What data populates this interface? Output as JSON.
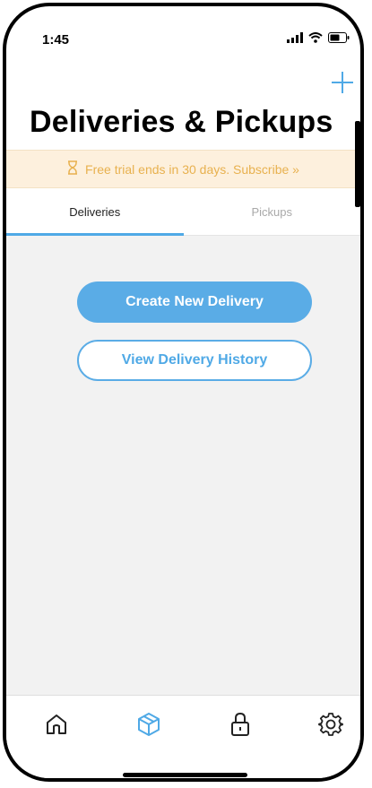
{
  "status_bar": {
    "time": "1:45",
    "icons": [
      "cellular-signal-icon",
      "wifi-icon",
      "battery-icon"
    ]
  },
  "header": {
    "add_icon": "plus-icon",
    "title": "Deliveries & Pickups"
  },
  "banner": {
    "icon": "hourglass-icon",
    "text": "Free trial ends in 30 days. Subscribe »"
  },
  "tabs": [
    {
      "label": "Deliveries",
      "active": true
    },
    {
      "label": "Pickups",
      "active": false
    }
  ],
  "actions": {
    "create_label": "Create New Delivery",
    "history_label": "View Delivery History"
  },
  "tab_bar": {
    "items": [
      {
        "icon": "home-icon",
        "active": false
      },
      {
        "icon": "package-icon",
        "active": true
      },
      {
        "icon": "lock-icon",
        "active": false
      },
      {
        "icon": "settings-gear-icon",
        "active": false
      }
    ]
  },
  "colors": {
    "accent": "#5aace6",
    "banner_bg": "#fdf0dd",
    "banner_text": "#e8b14f",
    "content_bg": "#f2f2f2",
    "icon_dark": "#222222",
    "tab_inactive": "#a9a9a9"
  }
}
